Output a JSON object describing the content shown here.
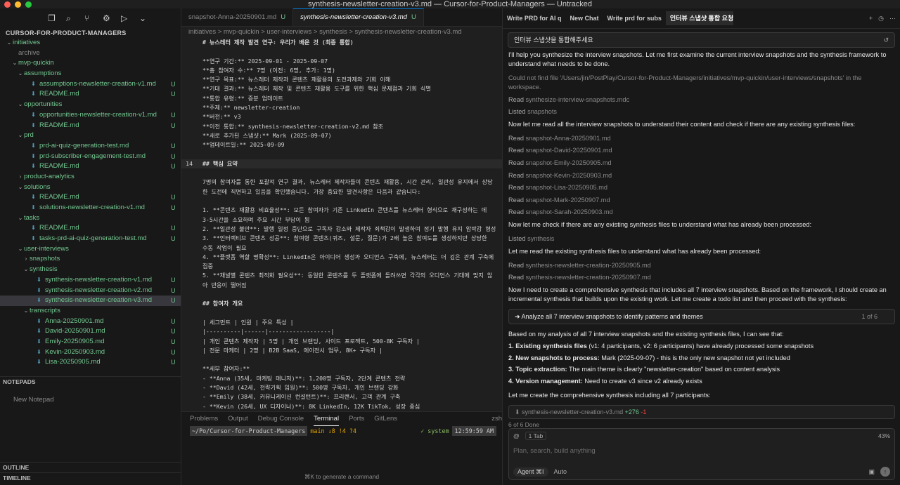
{
  "window": {
    "title": "synthesis-newsletter-creation-v3.md — Cursor-for-Product-Managers — Untracked"
  },
  "sidebar": {
    "header": "CURSOR-FOR-PRODUCT-MANAGERS",
    "rows": [
      {
        "label": "initiatives",
        "type": "folder",
        "indent": 0,
        "chev": "⌄"
      },
      {
        "label": "archive",
        "type": "dim",
        "indent": 1,
        "chev": ""
      },
      {
        "label": "mvp-quickin",
        "type": "folder",
        "indent": 1,
        "chev": "⌄"
      },
      {
        "label": "assumptions",
        "type": "folder",
        "indent": 2,
        "chev": "⌄"
      },
      {
        "label": "assumptions-newsletter-creation-v1.md",
        "type": "file",
        "indent": 3,
        "badge": "U"
      },
      {
        "label": "README.md",
        "type": "file",
        "indent": 3,
        "badge": "U"
      },
      {
        "label": "opportunities",
        "type": "folder",
        "indent": 2,
        "chev": "⌄"
      },
      {
        "label": "opportunities-newsletter-creation-v1.md",
        "type": "file",
        "indent": 3,
        "badge": "U"
      },
      {
        "label": "README.md",
        "type": "file",
        "indent": 3,
        "badge": "U"
      },
      {
        "label": "prd",
        "type": "folder",
        "indent": 2,
        "chev": "⌄"
      },
      {
        "label": "prd-ai-quiz-generation-test.md",
        "type": "file",
        "indent": 3,
        "badge": "U"
      },
      {
        "label": "prd-subscriber-engagement-test.md",
        "type": "file",
        "indent": 3,
        "badge": "U"
      },
      {
        "label": "README.md",
        "type": "file",
        "indent": 3,
        "badge": "U"
      },
      {
        "label": "product-analytics",
        "type": "folder",
        "indent": 2,
        "chev": "›"
      },
      {
        "label": "solutions",
        "type": "folder",
        "indent": 2,
        "chev": "⌄"
      },
      {
        "label": "README.md",
        "type": "file",
        "indent": 3,
        "badge": "U"
      },
      {
        "label": "solutions-newsletter-creation-v1.md",
        "type": "file",
        "indent": 3,
        "badge": "U"
      },
      {
        "label": "tasks",
        "type": "folder",
        "indent": 2,
        "chev": "⌄"
      },
      {
        "label": "README.md",
        "type": "file",
        "indent": 3,
        "badge": "U"
      },
      {
        "label": "tasks-prd-ai-quiz-generation-test.md",
        "type": "file",
        "indent": 3,
        "badge": "U"
      },
      {
        "label": "user-interviews",
        "type": "folder",
        "indent": 2,
        "chev": "⌄"
      },
      {
        "label": "snapshots",
        "type": "folder",
        "indent": 3,
        "chev": "›"
      },
      {
        "label": "synthesis",
        "type": "folder",
        "indent": 3,
        "chev": "⌄"
      },
      {
        "label": "synthesis-newsletter-creation-v1.md",
        "type": "file",
        "indent": 4,
        "badge": "U"
      },
      {
        "label": "synthesis-newsletter-creation-v2.md",
        "type": "file",
        "indent": 4,
        "badge": "U"
      },
      {
        "label": "synthesis-newsletter-creation-v3.md",
        "type": "file",
        "indent": 4,
        "badge": "U",
        "selected": true
      },
      {
        "label": "transcripts",
        "type": "folder",
        "indent": 3,
        "chev": "⌄"
      },
      {
        "label": "Anna-20250901.md",
        "type": "file",
        "indent": 4,
        "badge": "U"
      },
      {
        "label": "David-20250901.md",
        "type": "file",
        "indent": 4,
        "badge": "U"
      },
      {
        "label": "Emily-20250905.md",
        "type": "file",
        "indent": 4,
        "badge": "U"
      },
      {
        "label": "Kevin-20250903.md",
        "type": "file",
        "indent": 4,
        "badge": "U"
      },
      {
        "label": "Lisa-20250905.md",
        "type": "file",
        "indent": 4,
        "badge": "U"
      }
    ],
    "notepads_header": "NOTEPADS",
    "new_notepad": "New Notepad",
    "outline_header": "OUTLINE",
    "timeline_header": "TIMELINE"
  },
  "editor": {
    "tabs": [
      {
        "label": "snapshot-Anna-20250901.md",
        "mark": "U",
        "active": false
      },
      {
        "label": "synthesis-newsletter-creation-v3.md",
        "mark": "U",
        "active": true
      }
    ],
    "breadcrumb": "initiatives  >  mvp-quickin  >  user-interviews  >  synthesis  >  synthesis-newsletter-creation-v3.md",
    "lines": [
      {
        "n": "",
        "t": "# 뉴스레터 제작 발견 연구: 우리가 배운 것 (최종 통합)",
        "k": "hd"
      },
      {
        "n": "",
        "t": "",
        "k": ""
      },
      {
        "n": "",
        "t": "**연구 기간:** 2025-09-01 - 2025-09-07",
        "k": ""
      },
      {
        "n": "",
        "t": "**총 참여자 수:** 7명 (이전: 6명, 추가: 1명)",
        "k": ""
      },
      {
        "n": "",
        "t": "**연구 목표:** 뉴스레터 제작과 콘텐츠 재활용의 도전과제와 기회 이해",
        "k": ""
      },
      {
        "n": "",
        "t": "**기대 결과:** 뉴스레터 제작 및 콘텐츠 재활용 도구를 위한 핵심 문제점과 기회 식별",
        "k": ""
      },
      {
        "n": "",
        "t": "**통합 유형:** 증분 업데이트",
        "k": ""
      },
      {
        "n": "",
        "t": "**주제:** newsletter-creation",
        "k": ""
      },
      {
        "n": "",
        "t": "**버전:** v3",
        "k": ""
      },
      {
        "n": "",
        "t": "**이전 통합:** synthesis-newsletter-creation-v2.md 참조",
        "k": ""
      },
      {
        "n": "",
        "t": "**새로 추가된 스냅샷:** Mark (2025-09-07)",
        "k": ""
      },
      {
        "n": "",
        "t": "**업데이트일:** 2025-09-09",
        "k": ""
      },
      {
        "n": "",
        "t": "",
        "k": ""
      },
      {
        "n": "14",
        "t": "## 핵심 요약",
        "k": "hd cur"
      },
      {
        "n": "",
        "t": "",
        "k": ""
      },
      {
        "n": "",
        "t": "7명의 참여자를 통한 포괄적 연구 결과, 뉴스레터 제작자들이 콘텐츠 재활용, 시간 관리, 일관성 유지에서 상당",
        "k": ""
      },
      {
        "n": "",
        "t": "한 도전에 직면하고 있음을 확인했습니다. 가장 중요한 발견사항은 다음과 같습니다:",
        "k": ""
      },
      {
        "n": "",
        "t": "",
        "k": ""
      },
      {
        "n": "",
        "t": "1. **콘텐츠 재활용 비효율성**: 모든 참여자가 기존 LinkedIn 콘텐츠를 뉴스레터 형식으로 재구성하는 데",
        "k": ""
      },
      {
        "n": "",
        "t": "3-5시간을 소요하며 주요 시간 부담이 됨",
        "k": ""
      },
      {
        "n": "",
        "t": "2. **일관성 불안**: 발행 일정 중단으로 구독자 감소와 제작자 죄책감이 발생하여 정기 발행 유지 압박감 형성",
        "k": ""
      },
      {
        "n": "",
        "t": "3. **인터랙티브 콘텐츠 성공**: 참여형 콘텐츠(퀴즈, 설문, 질문)가 2배 높은 참여도를 생성하지만 상당한",
        "k": ""
      },
      {
        "n": "",
        "t": "수동 작업이 필요",
        "k": ""
      },
      {
        "n": "",
        "t": "4. **플랫폼 역할 명확성**: LinkedIn은 아이디어 생성과 오디언스 구축에, 뉴스레터는 더 깊은 관계 구축에",
        "k": ""
      },
      {
        "n": "",
        "t": "집중",
        "k": ""
      },
      {
        "n": "",
        "t": "5. **채널별 콘텐츠 최적화 필요성**: 동일한 콘텐츠를 두 플랫폼에 돌려쓰면 각각의 오디언스 기대에 맞지 않",
        "k": ""
      },
      {
        "n": "",
        "t": "아 반응이 떨어짐",
        "k": ""
      },
      {
        "n": "",
        "t": "",
        "k": ""
      },
      {
        "n": "",
        "t": "## 참여자 개요",
        "k": "hd"
      },
      {
        "n": "",
        "t": "",
        "k": ""
      },
      {
        "n": "",
        "t": "| 세그먼트 | 인원 | 주요 특성 |",
        "k": ""
      },
      {
        "n": "",
        "t": "|----------|------|------------------|",
        "k": "acc"
      },
      {
        "n": "",
        "t": "| 개인 콘텐츠 제작자 | 5명 | 개인 브랜딩, 사이드 프로젝트, 500-8K 구독자 |",
        "k": ""
      },
      {
        "n": "",
        "t": "| 전문 마케터 | 2명 | B2B SaaS, 에이전시 업무, 8K+ 구독자 |",
        "k": ""
      },
      {
        "n": "",
        "t": "",
        "k": ""
      },
      {
        "n": "",
        "t": "**세부 참여자:**",
        "k": ""
      },
      {
        "n": "",
        "t": "- **Anna (35세, 마케팅 매니저)**: 1,200명 구독자, 2단계 콘텐츠 전략",
        "k": ""
      },
      {
        "n": "",
        "t": "- **David (42세, 전략기획 임원)**: 500명 구독자, 개인 브랜딩 강화",
        "k": ""
      },
      {
        "n": "",
        "t": "- **Emily (38세, 커뮤니케이션 컨설턴트)**: 프리랜서, 고객 관계 구축",
        "k": ""
      },
      {
        "n": "",
        "t": "- **Kevin (26세, UX 디자이너)**: 8K LinkedIn, 12K TikTok, 성장 중심",
        "k": ""
      },
      {
        "n": "",
        "t": "- **Lisa (29세, B2B SaaS 마케터)**: 8,000명 구독자 관리, A/B 테스트 전문",
        "k": ""
      },
      {
        "n": "",
        "t": "- **Mark (40세, 테크 컨설턴트)**: 3,200명 구독자, 채널 분리 전략",
        "k": ""
      },
      {
        "n": "",
        "t": "- **Sarah (34세, 콘텐츠 에이전시)**: 6명 팀, 다양한 클라이언트 관리",
        "k": ""
      }
    ]
  },
  "panel": {
    "tabs": [
      "Problems",
      "Output",
      "Debug Console",
      "Terminal",
      "Ports",
      "GitLens"
    ],
    "active_tab": "Terminal",
    "shell": "zsh",
    "prompt_path": "~/Po/Cursor-for-Product-Managers",
    "prompt_git": "main ↓8 !4 ?4",
    "prompt_status": "✓ system",
    "prompt_time": "12:59:59 AM",
    "generate_hint": "⌘K to generate a command"
  },
  "chat": {
    "tabs": [
      {
        "label": "Write PRD for AI q",
        "active": false
      },
      {
        "label": "New Chat",
        "active": false
      },
      {
        "label": "Write prd for subs",
        "active": false
      },
      {
        "label": "인터뷰 스냅샷 통합 요청",
        "active": true
      }
    ],
    "user_query": "인터뷰 스냅샷을 통합해주세요",
    "messages": [
      {
        "kind": "text",
        "text": "I'll help you synthesize the interview snapshots. Let me first examine the current interview snapshots and the synthesis framework to understand what needs to be done."
      },
      {
        "kind": "tool",
        "text": "Could not find file '/Users/jin/PostPlay/Cursor-for-Product-Managers/initiatives/mvp-quickin/user-interviews/snapshots' in the workspace."
      },
      {
        "kind": "tool",
        "verb": "Read",
        "text": "synthesize-interview-snapshots.mdc"
      },
      {
        "kind": "tool",
        "verb": "Listed",
        "text": "snapshots"
      },
      {
        "kind": "text",
        "text": "Now let me read all the interview snapshots to understand their content and check if there are any existing synthesis files:"
      },
      {
        "kind": "tool",
        "verb": "Read",
        "text": "snapshot-Anna-20250901.md"
      },
      {
        "kind": "tool",
        "verb": "Read",
        "text": "snapshot-David-20250901.md"
      },
      {
        "kind": "tool",
        "verb": "Read",
        "text": "snapshot-Emily-20250905.md"
      },
      {
        "kind": "tool",
        "verb": "Read",
        "text": "snapshot-Kevin-20250903.md"
      },
      {
        "kind": "tool",
        "verb": "Read",
        "text": "snapshot-Lisa-20250905.md"
      },
      {
        "kind": "tool",
        "verb": "Read",
        "text": "snapshot-Mark-20250907.md"
      },
      {
        "kind": "tool",
        "verb": "Read",
        "text": "snapshot-Sarah-20250903.md"
      },
      {
        "kind": "text",
        "text": "Now let me check if there are any existing synthesis files to understand what has already been processed:"
      },
      {
        "kind": "tool",
        "verb": "Listed",
        "text": "synthesis"
      },
      {
        "kind": "text",
        "text": "Let me read the existing synthesis files to understand what has already been processed:"
      },
      {
        "kind": "tool",
        "verb": "Read",
        "text": "synthesis-newsletter-creation-20250905.md"
      },
      {
        "kind": "tool",
        "verb": "Read",
        "text": "synthesis-newsletter-creation-20250907.md"
      },
      {
        "kind": "text",
        "text": "Now I need to create a comprehensive synthesis that includes all 7 interview snapshots. Based on the framework, I should create an incremental synthesis that builds upon the existing work. Let me create a todo list and then proceed with the synthesis:"
      }
    ],
    "todo": {
      "label": "Analyze all 7 interview snapshots to identify patterns and themes",
      "count": "1 of 6"
    },
    "analysis_intro": "Based on my analysis of all 7 interview snapshots and the existing synthesis files, I can see that:",
    "analysis_points": [
      {
        "bold": "1. Existing synthesis files",
        "rest": " (v1: 4 participants, v2: 6 participants) have already processed some snapshots"
      },
      {
        "bold": "2. New snapshots to process:",
        "rest": " Mark (2025-09-07) - this is the only new snapshot not yet included"
      },
      {
        "bold": "3. Topic extraction:",
        "rest": " The main theme is clearly \"newsletter-creation\" based on content analysis"
      },
      {
        "bold": "4. Version management:",
        "rest": " Need to create v3 since v2 already exists"
      }
    ],
    "closing": "Let me create the comprehensive synthesis including all 7 participants:",
    "diff": {
      "file": "synthesis-newsletter-creation-v3.md",
      "plus": "+276",
      "minus": "-1"
    },
    "pending": "6 of 6 Done",
    "composer": {
      "context": "1 Tab",
      "percent": "43%",
      "placeholder": "Plan, search, build anything",
      "agent": "Agent ⌘I",
      "auto": "Auto"
    }
  }
}
